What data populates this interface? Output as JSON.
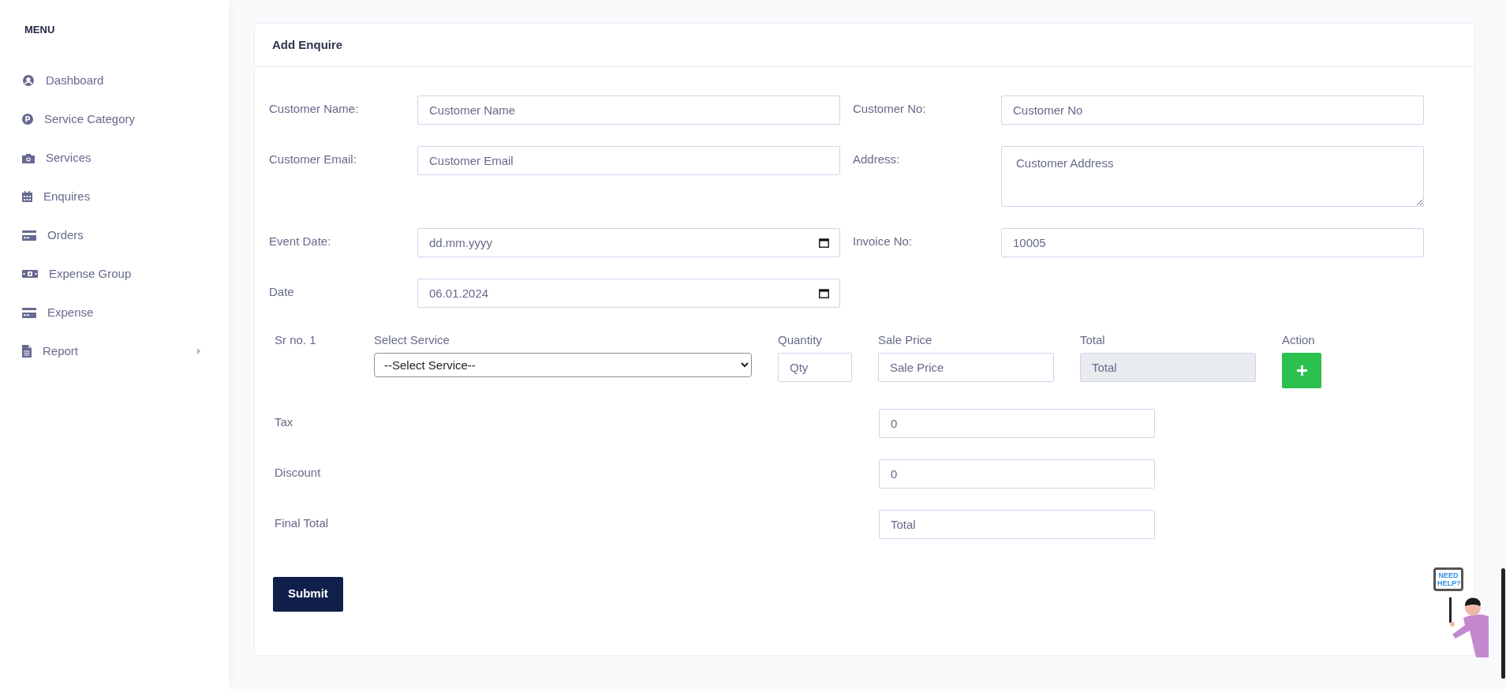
{
  "sidebar": {
    "heading": "MENU",
    "items": [
      {
        "label": "Dashboard",
        "expandable": false
      },
      {
        "label": "Service Category",
        "expandable": false
      },
      {
        "label": "Services",
        "expandable": false
      },
      {
        "label": "Enquires",
        "expandable": false
      },
      {
        "label": "Orders",
        "expandable": false
      },
      {
        "label": "Expense Group",
        "expandable": false
      },
      {
        "label": "Expense",
        "expandable": false
      },
      {
        "label": "Report",
        "expandable": true
      }
    ]
  },
  "form": {
    "title": "Add Enquire",
    "fields": [
      {
        "label": "Customer Name:",
        "kind": "text",
        "placeholder": "Customer Name"
      },
      {
        "label": "Customer No:",
        "kind": "text",
        "placeholder": "Customer No"
      },
      {
        "label": "Customer Email:",
        "kind": "text",
        "placeholder": "Customer Email"
      },
      {
        "label": "Address:",
        "kind": "textarea",
        "placeholder": "Customer Address"
      },
      {
        "label": "Event Date:",
        "kind": "date",
        "placeholder": "dd.mm.yyyy"
      },
      {
        "label": "Invoice No:",
        "kind": "text",
        "value": "10005"
      },
      {
        "label": "Date",
        "kind": "date",
        "value": "06.01.2024"
      }
    ],
    "line_items": {
      "columns": [
        "Select Service",
        "Quantity",
        "Sale Price",
        "Total",
        "Action"
      ],
      "rows": [
        {
          "sr": "Sr no. 1",
          "service": "--Select Service--",
          "quantity_placeholder": "Qty",
          "price_placeholder": "Sale Price",
          "total_placeholder": "Total",
          "total_disabled": true
        }
      ]
    },
    "totals": [
      {
        "label": "Tax",
        "value": "0"
      },
      {
        "label": "Discount",
        "value": "0"
      },
      {
        "label": "Final Total",
        "placeholder": "Total"
      }
    ],
    "submit": "Submit"
  },
  "help_widget": {
    "sign": "NEED HELP?"
  }
}
